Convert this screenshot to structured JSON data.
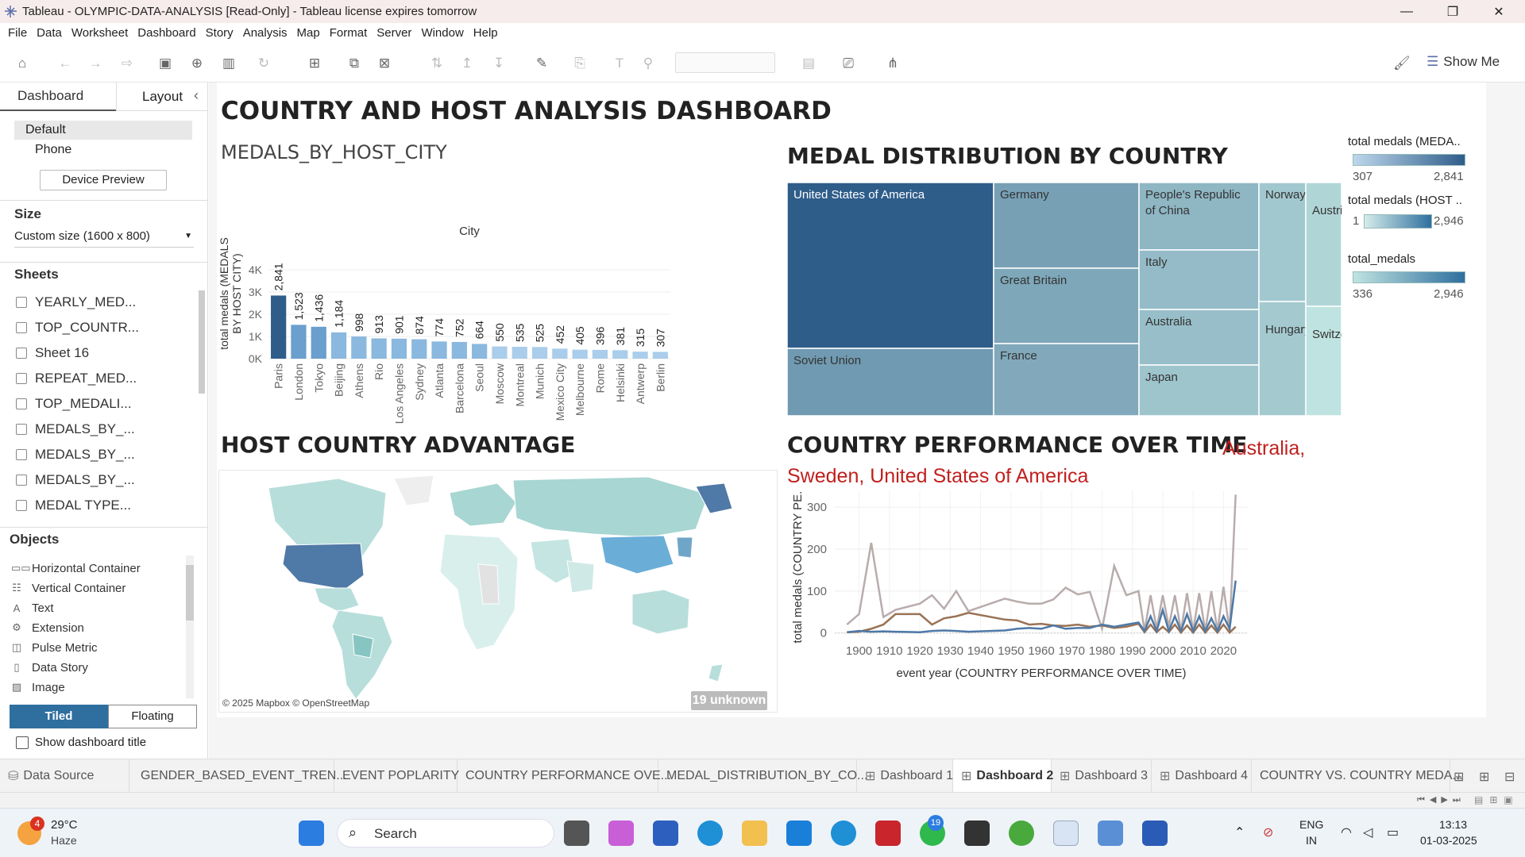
{
  "window": {
    "title": "Tableau - OLYMPIC-DATA-ANALYSIS [Read-Only] - Tableau license expires tomorrow",
    "minimize": "—",
    "restore": "❐",
    "close": "✕"
  },
  "menu": [
    "File",
    "Data",
    "Worksheet",
    "Dashboard",
    "Story",
    "Analysis",
    "Map",
    "Format",
    "Server",
    "Window",
    "Help"
  ],
  "toolbar": {
    "show_me": "Show Me"
  },
  "left_panel": {
    "tab_dashboard": "Dashboard",
    "tab_layout": "Layout",
    "collapse": "‹",
    "device_default": "Default",
    "device_phone": "Phone",
    "device_preview": "Device Preview",
    "size_header": "Size",
    "size_value": "Custom size (1600 x 800)",
    "sheets_header": "Sheets",
    "sheets": [
      "YEARLY_MED...",
      "TOP_COUNTR...",
      "Sheet 16",
      "REPEAT_MED...",
      "TOP_MEDALI...",
      "MEDALS_BY_...",
      "MEDALS_BY_...",
      "MEDALS_BY_...",
      "MEDAL TYPE..."
    ],
    "objects_header": "Objects",
    "objects": [
      {
        "icon": "horizontal-container-icon",
        "label": "Horizontal Container"
      },
      {
        "icon": "vertical-container-icon",
        "label": "Vertical Container"
      },
      {
        "icon": "text-icon",
        "label": "Text"
      },
      {
        "icon": "extension-icon",
        "label": "Extension"
      },
      {
        "icon": "pulse-metric-icon",
        "label": "Pulse Metric"
      },
      {
        "icon": "data-story-icon",
        "label": "Data Story"
      },
      {
        "icon": "image-icon",
        "label": "Image"
      }
    ],
    "tiled": "Tiled",
    "floating": "Floating",
    "show_title": "Show dashboard title"
  },
  "dashboard": {
    "title": "COUNTRY AND HOST ANALYSIS DASHBOARD",
    "bar_title": "MEDALS_BY_HOST_CITY",
    "treemap_title": "MEDAL DISTRIBUTION BY COUNTRY",
    "map_title": "HOST COUNTRY ADVANTAGE",
    "line_title": "COUNTRY PERFORMANCE OVER TIME",
    "line_subtitle": "Australia, Sweden, United States of America",
    "map_attribution": "© 2025 Mapbox © OpenStreetMap",
    "map_unknown": "19 unknown",
    "legends": [
      {
        "title": "total medals (MEDA..",
        "min": "307",
        "max": "2,841",
        "color_lo": "#bdd7ec",
        "color_hi": "#2f5d8a"
      },
      {
        "title": "total medals (HOST ..",
        "min": "1",
        "max": "2,946",
        "color_lo": "#d4ecea",
        "color_hi": "#2f6f9f"
      },
      {
        "title": "total_medals",
        "min": "336",
        "max": "2,946",
        "color_lo": "#bfe3e0",
        "color_hi": "#2f6f9f"
      }
    ]
  },
  "chart_data": [
    {
      "type": "bar",
      "title": "MEDALS_BY_HOST_CITY",
      "xlabel": "City",
      "ylabel": "total medals (MEDALS BY HOST CITY)",
      "categories": [
        "Paris",
        "London",
        "Tokyo",
        "Beijing",
        "Athens",
        "Rio",
        "Los Angeles",
        "Sydney",
        "Atlanta",
        "Barcelona",
        "Seoul",
        "Moscow",
        "Montreal",
        "Munich",
        "Mexico City",
        "Melbourne",
        "Rome",
        "Helsinki",
        "Antwerp",
        "Berlin"
      ],
      "values": [
        2841,
        1523,
        1436,
        1184,
        998,
        913,
        901,
        874,
        774,
        752,
        664,
        550,
        535,
        525,
        452,
        405,
        396,
        381,
        315,
        307
      ],
      "labels": [
        "2,841",
        "1,523",
        "1,436",
        "1,184",
        "998",
        "913",
        "901",
        "874",
        "774",
        "752",
        "664",
        "550",
        "535",
        "525",
        "452",
        "405",
        "396",
        "381",
        "315",
        "307"
      ],
      "yticks": [
        "0K",
        "1K",
        "2K",
        "3K",
        "4K"
      ],
      "ylim": [
        0,
        4000
      ],
      "grid": true
    },
    {
      "type": "treemap",
      "title": "MEDAL DISTRIBUTION BY COUNTRY",
      "items": [
        {
          "label": "United States of America",
          "value": 2946
        },
        {
          "label": "Soviet Union",
          "value": 1204
        },
        {
          "label": "Germany",
          "value": 1080
        },
        {
          "label": "Great Britain",
          "value": 950
        },
        {
          "label": "France",
          "value": 900
        },
        {
          "label": "People's Republic of China",
          "value": 700
        },
        {
          "label": "Italy",
          "value": 620
        },
        {
          "label": "Australia",
          "value": 580
        },
        {
          "label": "Japan",
          "value": 520
        },
        {
          "label": "Norway",
          "value": 480
        },
        {
          "label": "Hungary",
          "value": 460
        },
        {
          "label": "Austria",
          "value": 380
        },
        {
          "label": "Switzerland",
          "value": 336
        }
      ]
    },
    {
      "type": "line",
      "title": "COUNTRY PERFORMANCE OVER TIME",
      "xlabel": "event year (COUNTRY PERFORMANCE OVER TIME)",
      "ylabel": "total medals (COUNTRY PE...",
      "xticks": [
        "1900",
        "1910",
        "1920",
        "1930",
        "1940",
        "1950",
        "1960",
        "1970",
        "1980",
        "1990",
        "2000",
        "2010",
        "2020"
      ],
      "yticks": [
        "0",
        "100",
        "200",
        "300"
      ],
      "xlim": [
        1892,
        2028
      ],
      "ylim": [
        -10,
        340
      ],
      "grid": true,
      "series": [
        {
          "color": "#b9acac",
          "x": [
            1896,
            1900,
            1904,
            1908,
            1912,
            1920,
            1924,
            1928,
            1932,
            1936,
            1948,
            1952,
            1956,
            1960,
            1964,
            1968,
            1972,
            1976,
            1980,
            1984,
            1988,
            1992,
            1994,
            1996,
            1998,
            2000,
            2002,
            2004,
            2006,
            2008,
            2010,
            2012,
            2014,
            2016,
            2018,
            2020,
            2022,
            2024
          ],
          "y": [
            20,
            45,
            215,
            38,
            55,
            70,
            90,
            58,
            100,
            52,
            82,
            75,
            70,
            70,
            80,
            108,
            92,
            98,
            10,
            160,
            90,
            100,
            5,
            90,
            10,
            90,
            15,
            90,
            5,
            95,
            5,
            95,
            5,
            100,
            5,
            110,
            5,
            330
          ]
        },
        {
          "color": "#9a7255",
          "x": [
            1896,
            1900,
            1904,
            1908,
            1912,
            1920,
            1924,
            1928,
            1932,
            1936,
            1948,
            1952,
            1956,
            1960,
            1964,
            1968,
            1972,
            1976,
            1980,
            1984,
            1988,
            1992,
            1994,
            1996,
            1998,
            2000,
            2002,
            2004,
            2006,
            2008,
            2010,
            2012,
            2014,
            2016,
            2018,
            2020,
            2022,
            2024
          ],
          "y": [
            2,
            3,
            10,
            20,
            45,
            45,
            20,
            35,
            40,
            48,
            32,
            30,
            20,
            22,
            18,
            17,
            20,
            15,
            18,
            12,
            15,
            22,
            2,
            20,
            2,
            15,
            2,
            20,
            1,
            18,
            1,
            20,
            1,
            18,
            1,
            20,
            1,
            15
          ]
        },
        {
          "color": "#4e79a7",
          "x": [
            1896,
            1900,
            1904,
            1908,
            1912,
            1920,
            1924,
            1928,
            1932,
            1936,
            1948,
            1952,
            1956,
            1960,
            1964,
            1968,
            1972,
            1976,
            1980,
            1984,
            1988,
            1992,
            1994,
            1996,
            1998,
            2000,
            2002,
            2004,
            2006,
            2008,
            2010,
            2012,
            2014,
            2016,
            2018,
            2020,
            2022,
            2024
          ],
          "y": [
            2,
            5,
            3,
            4,
            3,
            2,
            5,
            6,
            5,
            3,
            6,
            10,
            12,
            10,
            18,
            10,
            12,
            12,
            20,
            15,
            20,
            25,
            5,
            40,
            5,
            55,
            5,
            40,
            5,
            45,
            5,
            40,
            5,
            35,
            5,
            40,
            10,
            125
          ]
        }
      ]
    }
  ],
  "bottom_tabs": [
    {
      "label": "Data Source",
      "icon": "data-source-icon"
    },
    {
      "label": "GENDER_BASED_EVENT_TREN..."
    },
    {
      "label": "EVENT POPLARITY"
    },
    {
      "label": "COUNTRY PERFORMANCE OVE..."
    },
    {
      "label": "MEDAL_DISTRIBUTION_BY_CO..."
    },
    {
      "label": "Dashboard 1",
      "icon": "dashboard-icon"
    },
    {
      "label": "Dashboard 2",
      "icon": "dashboard-icon",
      "active": true
    },
    {
      "label": "Dashboard 3",
      "icon": "dashboard-icon"
    },
    {
      "label": "Dashboard 4",
      "icon": "dashboard-icon"
    },
    {
      "label": "COUNTRY VS. COUNTRY MEDA..."
    }
  ],
  "taskbar": {
    "weather_temp": "29°C",
    "weather_desc": "Haze",
    "weather_badge": "4",
    "search": "Search",
    "lang1": "ENG",
    "lang2": "IN",
    "time": "13:13",
    "date": "01-03-2025",
    "whatsapp_badge": "19"
  }
}
